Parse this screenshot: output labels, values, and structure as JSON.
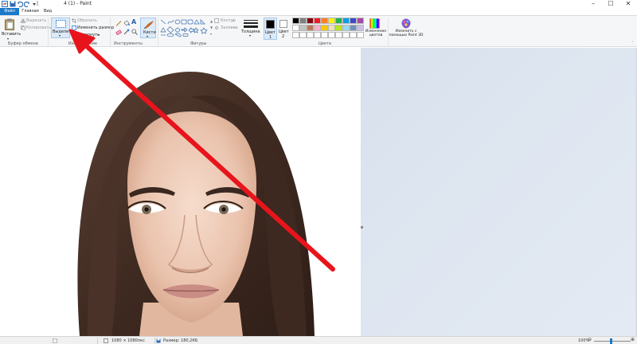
{
  "app": {
    "title": "4 (1) - Paint"
  },
  "window_controls": {
    "minimize": "–",
    "maximize": "☐",
    "close": "✕"
  },
  "tabs": [
    {
      "label": "Файл"
    },
    {
      "label": "Главная"
    },
    {
      "label": "Вид"
    }
  ],
  "ribbon": {
    "clipboard": {
      "paste_label": "Вставить",
      "cut_label": "Вырезать",
      "copy_label": "Копировать",
      "group_label": "Буфер обмена"
    },
    "image": {
      "select_label": "Выделить",
      "crop_label": "Обрезать",
      "resize_label": "Изменить размер",
      "rotate_label": "Повернуть",
      "group_label": "Изображение"
    },
    "tools": {
      "group_label": "Инструменты"
    },
    "brushes": {
      "label": "Кисти"
    },
    "shapes": {
      "outline_label": "Контур",
      "fill_label": "Заливка",
      "group_label": "Фигуры"
    },
    "size": {
      "label": "Толщина"
    },
    "colors": {
      "color1_label": "Цвет",
      "color1_num": "1",
      "color2_label": "Цвет",
      "color2_num": "2",
      "edit_colors_label": "Изменение цветов",
      "group_label": "Цвета",
      "color1_value": "#000000",
      "color2_value": "#ffffff",
      "palette_row1": [
        "#000000",
        "#7f7f7f",
        "#880015",
        "#ed1c24",
        "#ff7f27",
        "#fff200",
        "#22b14c",
        "#00a2e8",
        "#3f48cc",
        "#a349a4"
      ],
      "palette_row2": [
        "#ffffff",
        "#c3c3c3",
        "#b97a57",
        "#ffaec9",
        "#ffc90e",
        "#efe4b0",
        "#b5e61d",
        "#99d9ea",
        "#7092be",
        "#c8bfe7"
      ],
      "palette_row3": [
        "#ffffff",
        "#ffffff",
        "#ffffff",
        "#ffffff",
        "#ffffff",
        "#ffffff",
        "#ffffff",
        "#ffffff",
        "#ffffff",
        "#ffffff"
      ]
    },
    "paint3d": {
      "label": "Изменить с помощью Paint 3D"
    }
  },
  "status": {
    "dimensions": "1080 × 1080пкс",
    "size": "Размер: 180,2КБ",
    "zoom": "100%"
  },
  "annotation": {
    "arrow_color": "#e8141c"
  }
}
